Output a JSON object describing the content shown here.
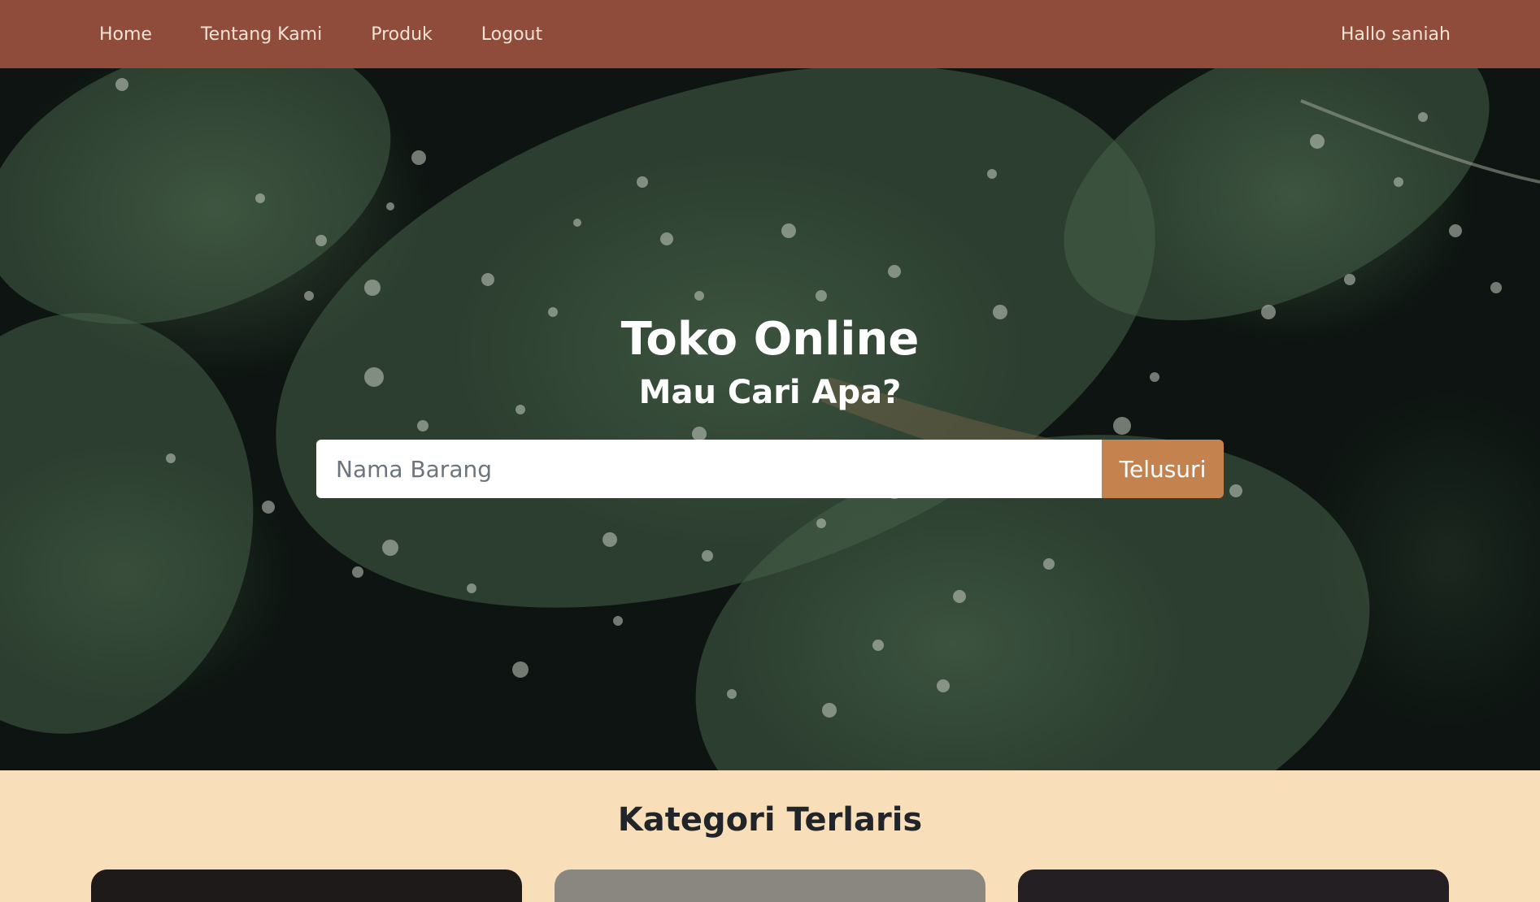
{
  "navbar": {
    "links": [
      {
        "label": "Home"
      },
      {
        "label": "Tentang Kami"
      },
      {
        "label": "Produk"
      },
      {
        "label": "Logout"
      }
    ],
    "greeting": "Hallo saniah",
    "background_color": "#8f4c3b"
  },
  "hero": {
    "title": "Toko Online",
    "subtitle": "Mau Cari Apa?",
    "search": {
      "placeholder": "Nama Barang",
      "value": "",
      "button_label": "Telusuri",
      "button_color": "#c4824f"
    }
  },
  "category_section": {
    "heading": "Kategori Terlaris",
    "background_color": "#f9dfb9"
  }
}
